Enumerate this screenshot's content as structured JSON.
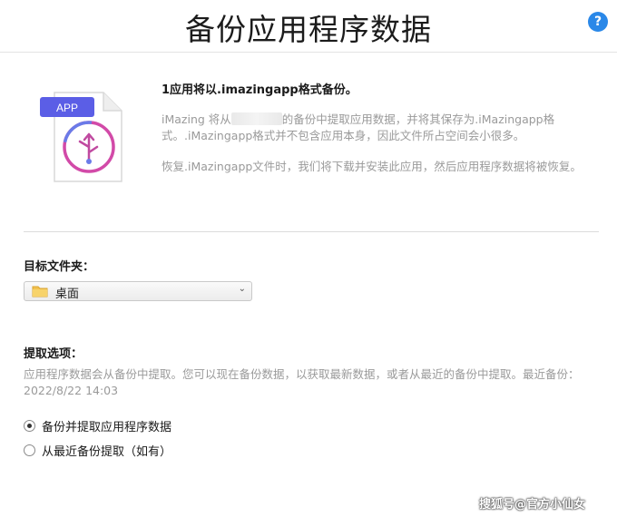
{
  "header": {
    "title": "备份应用程序数据",
    "help_glyph": "?"
  },
  "file_icon": {
    "badge": "APP",
    "badge_color": "#5b5ee6"
  },
  "info": {
    "heading": "1应用将以.imazingapp格式备份。",
    "para1_pre": "iMazing 将从",
    "para1_post": "的备份中提取应用数据，并将其保存为.iMazingapp格式。.iMazingapp格式并不包含应用本身，因此文件所占空间会小很多。",
    "para2": "恢复.iMazingapp文件时，我们将下载并安装此应用，然后应用程序数据将被恢复。"
  },
  "target": {
    "label": "目标文件夹：",
    "selected": "桌面",
    "icon": "folder-icon",
    "chevron": "⌄"
  },
  "extract": {
    "label": "提取选项：",
    "description": "应用程序数据会从备份中提取。您可以现在备份数据，以获取最新数据，或者从最近的备份中提取。最近备份：2022/8/22 14:03",
    "options": [
      {
        "label": "备份并提取应用程序数据",
        "selected": true
      },
      {
        "label": "从最近备份提取（如有）",
        "selected": false
      }
    ]
  },
  "watermark": "搜狐号@官方小仙女",
  "colors": {
    "accent": "#2a88e8"
  }
}
